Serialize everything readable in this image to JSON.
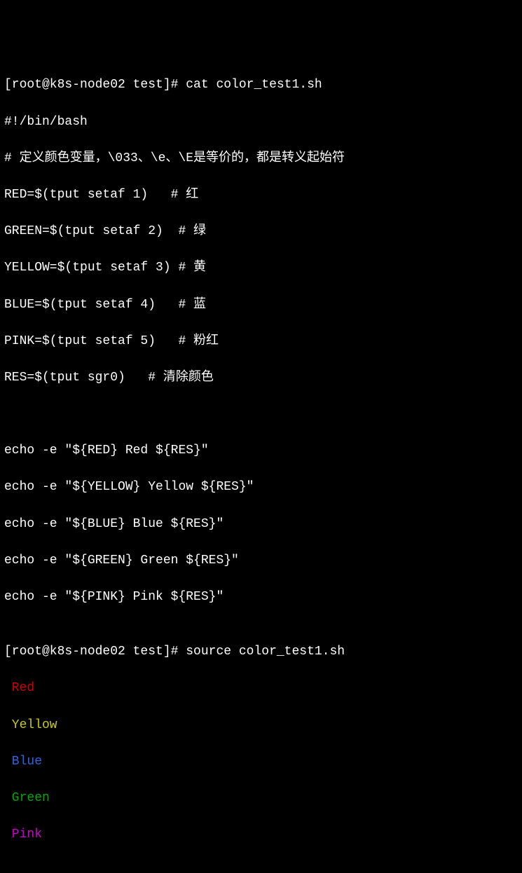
{
  "prompt1": "[root@k8s-node02 test]# ",
  "cmd1": "cat color_test1.sh",
  "script": {
    "shebang": "#!/bin/bash",
    "comment_def": "# 定义颜色变量，\\033、\\e、\\E是等价的，都是转义起始符",
    "line_red": "RED=$(tput setaf 1)   # 红",
    "line_green": "GREEN=$(tput setaf 2)  # 绿",
    "line_yellow": "YELLOW=$(tput setaf 3) # 黄",
    "line_blue": "BLUE=$(tput setaf 4)   # 蓝",
    "line_pink": "PINK=$(tput setaf 5)   # 粉红",
    "line_res": "RES=$(tput sgr0)   # 清除颜色",
    "blank1": "",
    "blank2": "",
    "echo_red": "echo -e \"${RED} Red ${RES}\"",
    "echo_yellow": "echo -e \"${YELLOW} Yellow ${RES}\"",
    "echo_blue": "echo -e \"${BLUE} Blue ${RES}\"",
    "echo_green": "echo -e \"${GREEN} Green ${RES}\"",
    "echo_pink": "echo -e \"${PINK} Pink ${RES}\""
  },
  "blank3": "",
  "prompt2": "[root@k8s-node02 test]# ",
  "cmd2": "source color_test1.sh",
  "output": {
    "red": " Red ",
    "yellow": " Yellow ",
    "blue": " Blue ",
    "green": " Green ",
    "pink": " Pink "
  }
}
